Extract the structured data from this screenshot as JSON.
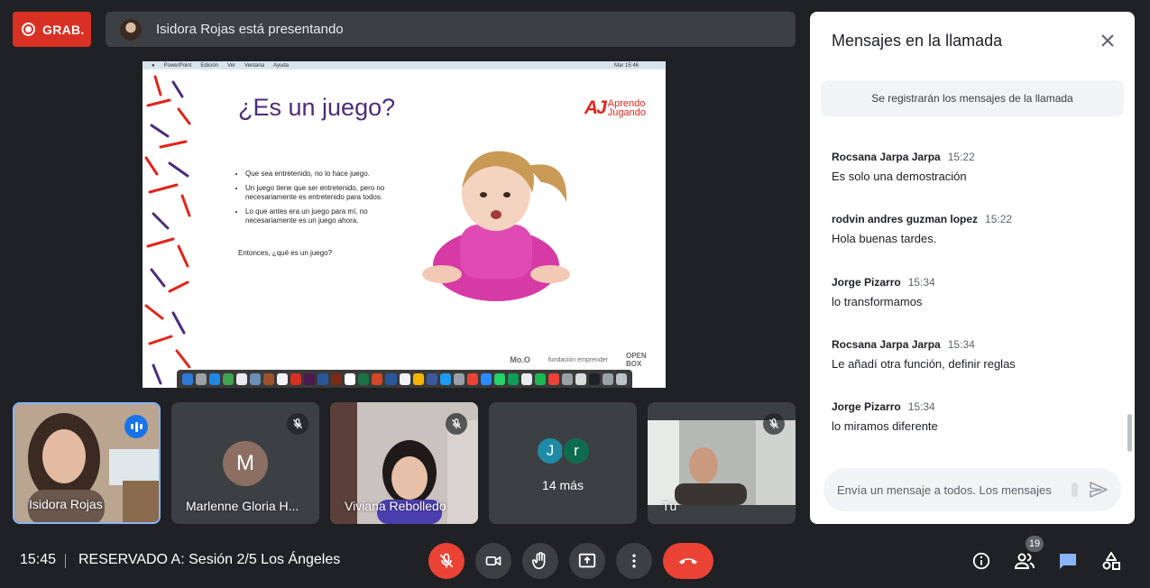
{
  "top": {
    "recording_label": "GRAB.",
    "presenting_text": "Isidora Rojas está presentando"
  },
  "slide": {
    "menubar": [
      "PowerPoint",
      "Edición",
      "Ver",
      "Ventana",
      "Ayuda"
    ],
    "menubar_right": "Mar 15:46",
    "title": "¿Es un juego?",
    "logo_mark": "AJ",
    "logo_text_1": "Aprendo",
    "logo_text_2": "Jugando",
    "bullets": [
      "Que sea entretenido, no lo hace juego.",
      "Un juego tiene que ser entretenido, pero no necesariamente es entretenido para todos.",
      "Lo que antes era un juego para mí, no necesariamente es un juego ahora."
    ],
    "question": "Entonces, ¿qué es un juego?",
    "footer_logos": [
      "Mo.O",
      "fundación emprender",
      "OPEN BOX"
    ]
  },
  "participants": [
    {
      "name": "Isidora Rojas",
      "state": "speaking"
    },
    {
      "name": "Marlenne Gloria H...",
      "initial": "M",
      "state": "muted"
    },
    {
      "name": "Viviana Rebolledo",
      "state": "muted"
    },
    {
      "more_label": "14 más",
      "initials": [
        "J",
        "r"
      ]
    },
    {
      "name": "Tú",
      "state": "muted"
    }
  ],
  "chat": {
    "title": "Mensajes en la llamada",
    "notice": "Se registrarán los mensajes de la llamada",
    "messages": [
      {
        "sender": "Rocsana Jarpa Jarpa",
        "time": "15:22",
        "text": "Es solo una demostración"
      },
      {
        "sender": "rodvin andres guzman lopez",
        "time": "15:22",
        "text": "Hola buenas tardes."
      },
      {
        "sender": "Jorge Pizarro",
        "time": "15:34",
        "text": "lo transformamos"
      },
      {
        "sender": "Rocsana Jarpa Jarpa",
        "time": "15:34",
        "text": "Le añadí otra función, definir reglas"
      },
      {
        "sender": "Jorge Pizarro",
        "time": "15:34",
        "text": "lo miramos diferente"
      }
    ],
    "input_placeholder": "Envía un mensaje a todos. Los mensajes"
  },
  "bottom": {
    "time": "15:45",
    "meeting_name": "RESERVADO A: Sesión 2/5 Los Ángeles",
    "people_count": "19"
  },
  "colors": {
    "background": "#202124",
    "tile": "#3c4043",
    "danger": "#ea4335",
    "accent": "#1a73e8",
    "slide_title": "#4b2c79"
  },
  "icons": [
    "record-icon",
    "mic-off-icon",
    "camera-icon",
    "raise-hand-icon",
    "present-icon",
    "more-vert-icon",
    "hang-up-icon",
    "info-icon",
    "people-icon",
    "chat-icon",
    "activities-icon",
    "close-icon",
    "send-icon"
  ]
}
